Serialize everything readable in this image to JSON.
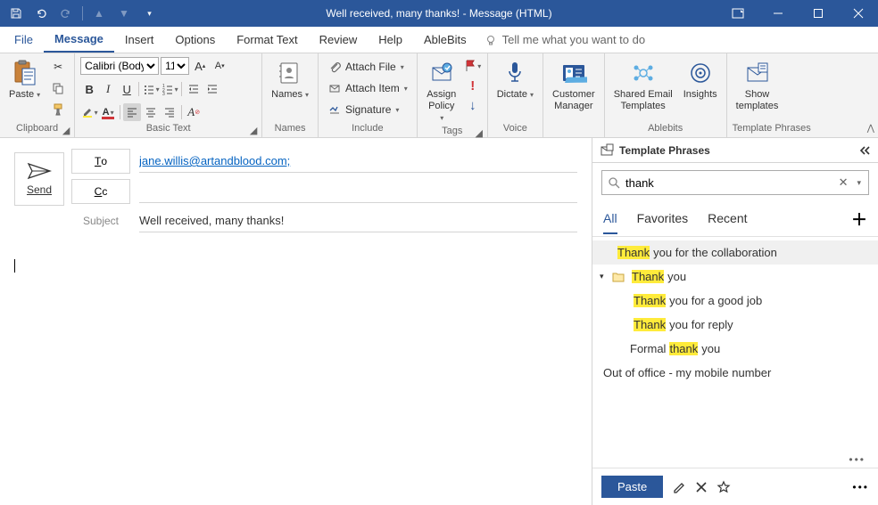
{
  "titlebar": {
    "title": "Well received, many thanks!  -  Message (HTML)"
  },
  "menu": {
    "file": "File",
    "message": "Message",
    "insert": "Insert",
    "options": "Options",
    "format_text": "Format Text",
    "review": "Review",
    "help": "Help",
    "ablebits": "AbleBits",
    "tellme": "Tell me what you want to do"
  },
  "ribbon": {
    "clipboard": {
      "label": "Clipboard",
      "paste": "Paste"
    },
    "basic_text": {
      "label": "Basic Text",
      "font": "Calibri (Body)",
      "size": "11"
    },
    "names": {
      "label": "Names",
      "btn": "Names"
    },
    "include": {
      "label": "Include",
      "attach_file": "Attach File",
      "attach_item": "Attach Item",
      "signature": "Signature"
    },
    "tags": {
      "label": "Tags",
      "assign_policy": "Assign\nPolicy"
    },
    "voice": {
      "label": "Voice",
      "dictate": "Dictate"
    },
    "cust": {
      "customer_manager": "Customer\nManager"
    },
    "ablebits": {
      "label": "Ablebits",
      "shared": "Shared Email\nTemplates",
      "insights": "Insights"
    },
    "template_phrases": {
      "label": "Template Phrases",
      "show": "Show\ntemplates"
    }
  },
  "compose": {
    "send": "Send",
    "to_btn": "To",
    "cc_btn": "Cc",
    "subject_lbl": "Subject",
    "to_value": "jane.willis@artandblood.com;",
    "cc_value": "",
    "subject_value": "Well received, many thanks!"
  },
  "template_pane": {
    "title": "Template Phrases",
    "search_value": "thank",
    "tabs": {
      "all": "All",
      "favorites": "Favorites",
      "recent": "Recent"
    },
    "items": [
      {
        "pre": "",
        "hl": "Thank",
        "post": " you for the collaboration",
        "selected": true,
        "indent": "root"
      },
      {
        "pre": "",
        "hl": "Thank",
        "post": " you",
        "folder": true
      },
      {
        "pre": "",
        "hl": "Thank",
        "post": " you for a good job",
        "indent": "child"
      },
      {
        "pre": "",
        "hl": "Thank",
        "post": " you for reply",
        "indent": "child"
      },
      {
        "pre": "Formal ",
        "hl": "thank",
        "post": " you",
        "indent": "child"
      }
    ],
    "nomatch": "Out of office - my mobile number",
    "paste": "Paste"
  }
}
